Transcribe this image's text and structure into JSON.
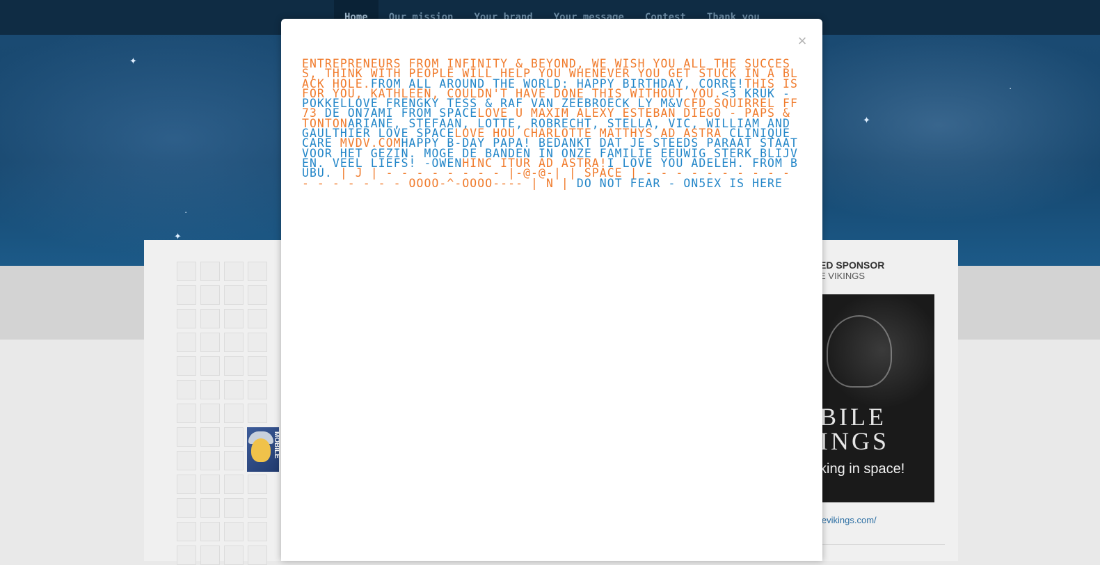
{
  "nav": {
    "items": [
      "Home",
      "Our mission",
      "Your brand",
      "Your message",
      "Contest",
      "Thank you"
    ]
  },
  "sponsor": {
    "title": "ED SPONSOR",
    "subtitle": "E VIKINGS",
    "ad_brand_line1": "BILE",
    "ad_brand_line2": "INGS",
    "ad_tagline": "king in space!",
    "link": "levikings.com/"
  },
  "thumb": {
    "label": "MOBILE"
  },
  "modal": {
    "close_label": "×",
    "messages": [
      {
        "text": "Entrepreneurs from infinity & beyond, we wish you all the success, ",
        "color": "#f07b2c"
      },
      {
        "text": "THINK",
        "color": "#f07b2c"
      },
      {
        "text": " with people will help you whenever you get stuck in a black hole.",
        "color": "#f07b2c"
      },
      {
        "text": "From all around the world: Happy Birthday, Corre!",
        "color": "#2386c8"
      },
      {
        "text": "This is for you, Kathleen, couldn't have done this without you.",
        "color": "#f07b2c"
      },
      {
        "text": "<3 Kruk - Pokkel",
        "color": "#2386c8"
      },
      {
        "text": "Love Frengky Tess & Raf Van Zeebroeck LY M",
        "color": "#2386c8"
      },
      {
        "text": "&V",
        "color": "#2386c8"
      },
      {
        "text": "CFD Squirrel FF73",
        "color": "#f07b2c"
      },
      {
        "text": " de ON7AMI from Space",
        "color": "#2386c8"
      },
      {
        "text": "Love u Maxim Alexy Esteban Diego - Paps & Tonton",
        "color": "#f07b2c"
      },
      {
        "text": "Ariane, Stefaan, Lotte, Robrecht, Stella, Vic, William and Gaulthier love space",
        "color": "#2386c8"
      },
      {
        "text": "Love hou Charlotte Matthys  ad astra  ",
        "color": "#f07b2c"
      },
      {
        "text": "Clinique Care  ",
        "color": "#2386c8"
      },
      {
        "text": "mvdv.com",
        "color": "#f07b2c"
      },
      {
        "text": "Happy B-day Papa! Bedankt dat je steeds paraat staat voor het gezin. Moge de banden in onze familie eeuwig sterk blijven. Veel liefs!  -Owen",
        "color": "#2386c8"
      },
      {
        "text": "Hinc itur ad astra!",
        "color": "#f07b2c"
      },
      {
        "text": "I love you Adeleh. From Bubu.",
        "color": "#2386c8"
      },
      {
        "text": "  |  J  | - - - - - - - -            |-@-@-|      | SPACE | - - - - - - - - - - - - - - - - - oOOO-^-OOOo----  |  N  |",
        "color": "#f07b2c"
      },
      {
        "text": " DO NOT FEAR - ON5EX IS HERE",
        "color": "#2386c8"
      }
    ]
  }
}
